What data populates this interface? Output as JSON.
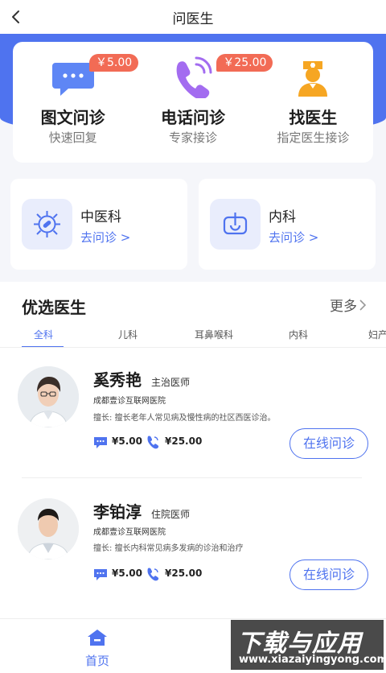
{
  "nav": {
    "title": "问医生"
  },
  "services": [
    {
      "name": "图文问诊",
      "sub": "快速回复",
      "price": "￥5.00",
      "icon": "chat-bubble-icon"
    },
    {
      "name": "电话问诊",
      "sub": "专家接诊",
      "price": "￥25.00",
      "icon": "phone-icon"
    },
    {
      "name": "找医生",
      "sub": "指定医生接诊",
      "icon": "doctor-icon"
    }
  ],
  "departments": [
    {
      "name": "中医科",
      "link": "去问诊 >",
      "icon": "virus-icon"
    },
    {
      "name": "内科",
      "link": "去问诊 >",
      "icon": "stomach-icon"
    }
  ],
  "doctors_section": {
    "title": "优选医生",
    "more": "更多",
    "tabs": [
      "全科",
      "儿科",
      "耳鼻喉科",
      "内科",
      "妇产"
    ],
    "active_tab": 0
  },
  "doctors": [
    {
      "name": "奚秀艳",
      "title": "主治医师",
      "hospital": "成都壹诊互联网医院",
      "specialty": "擅长: 擅长老年人常见病及慢性病的社区西医诊治。",
      "text_price": "¥5.00",
      "phone_price": "¥25.00",
      "button": "在线问诊"
    },
    {
      "name": "李铂淳",
      "title": "住院医师",
      "hospital": "成都壹诊互联网医院",
      "specialty": "擅长: 擅长内科常见病多发病的诊治和治疗",
      "text_price": "¥5.00",
      "phone_price": "¥25.00",
      "button": "在线问诊"
    }
  ],
  "tabbar": {
    "home": "首页"
  },
  "watermark": {
    "text": "下载与应用",
    "url": "www.xiazaiyingyong.com"
  },
  "colors": {
    "accent": "#4f73ef",
    "price_badge": "#f26b55",
    "phone_icon": "#a36cf0",
    "doctor_icon": "#f6a623"
  }
}
